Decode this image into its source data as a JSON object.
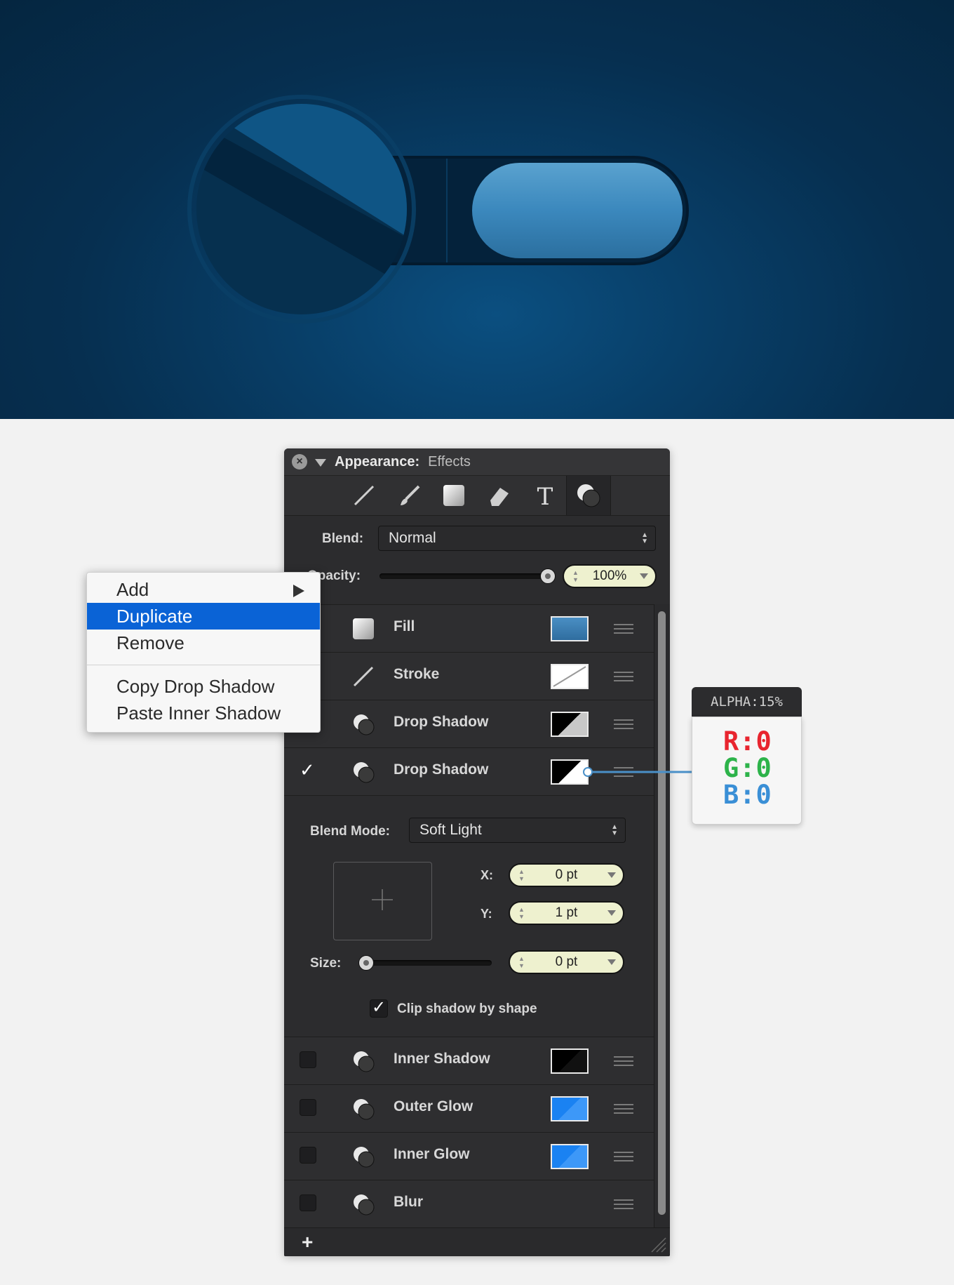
{
  "colors": {
    "hero_bg": "#062f50",
    "accent": "#0a63d6",
    "toggle_knob": "#3f8fc0"
  },
  "panel": {
    "title": "Appearance:",
    "subtitle": "Effects",
    "toolbar_icons": [
      "line-tool-icon",
      "brush-tool-icon",
      "rect-tool-icon",
      "tag-tool-icon",
      "text-tool-icon",
      "effects-tool-icon"
    ],
    "blend_label": "Blend:",
    "blend_value": "Normal",
    "opacity_label": "Opacity:",
    "opacity_value": "100%",
    "opacity_level": 1.0,
    "effects": [
      {
        "name": "Fill",
        "checked": false,
        "swatch": "fill-blue"
      },
      {
        "name": "Stroke",
        "checked": false,
        "swatch": "white-slash"
      },
      {
        "name": "Drop Shadow",
        "checked": false,
        "swatch": "black-grey"
      },
      {
        "name": "Drop Shadow",
        "checked": true,
        "swatch": "black-white"
      }
    ],
    "settings": {
      "blend_mode_label": "Blend Mode:",
      "blend_mode_value": "Soft Light",
      "x_label": "X:",
      "x_value": "0 pt",
      "y_label": "Y:",
      "y_value": "1 pt",
      "size_label": "Size:",
      "size_value": "0 pt",
      "size_level": 0.0,
      "clip_label": "Clip shadow by shape",
      "clip_checked": true
    },
    "effects_after": [
      {
        "name": "Inner Shadow",
        "checked": false,
        "swatch": "black"
      },
      {
        "name": "Outer Glow",
        "checked": false,
        "swatch": "blue"
      },
      {
        "name": "Inner Glow",
        "checked": false,
        "swatch": "blue"
      },
      {
        "name": "Blur",
        "checked": false,
        "swatch": "none"
      }
    ],
    "add_label": "+"
  },
  "menu": {
    "items": [
      {
        "label": "Add",
        "has_submenu": true
      },
      {
        "label": "Duplicate",
        "selected": true
      },
      {
        "label": "Remove"
      },
      {
        "label": "Copy Drop Shadow"
      },
      {
        "label": "Paste Inner Shadow"
      }
    ]
  },
  "callout": {
    "alpha": "ALPHA:15%",
    "r": "R:0",
    "g": "G:0",
    "b": "B:0",
    "r_color": "#e8252f",
    "g_color": "#2db34a",
    "b_color": "#3a8fd6"
  }
}
